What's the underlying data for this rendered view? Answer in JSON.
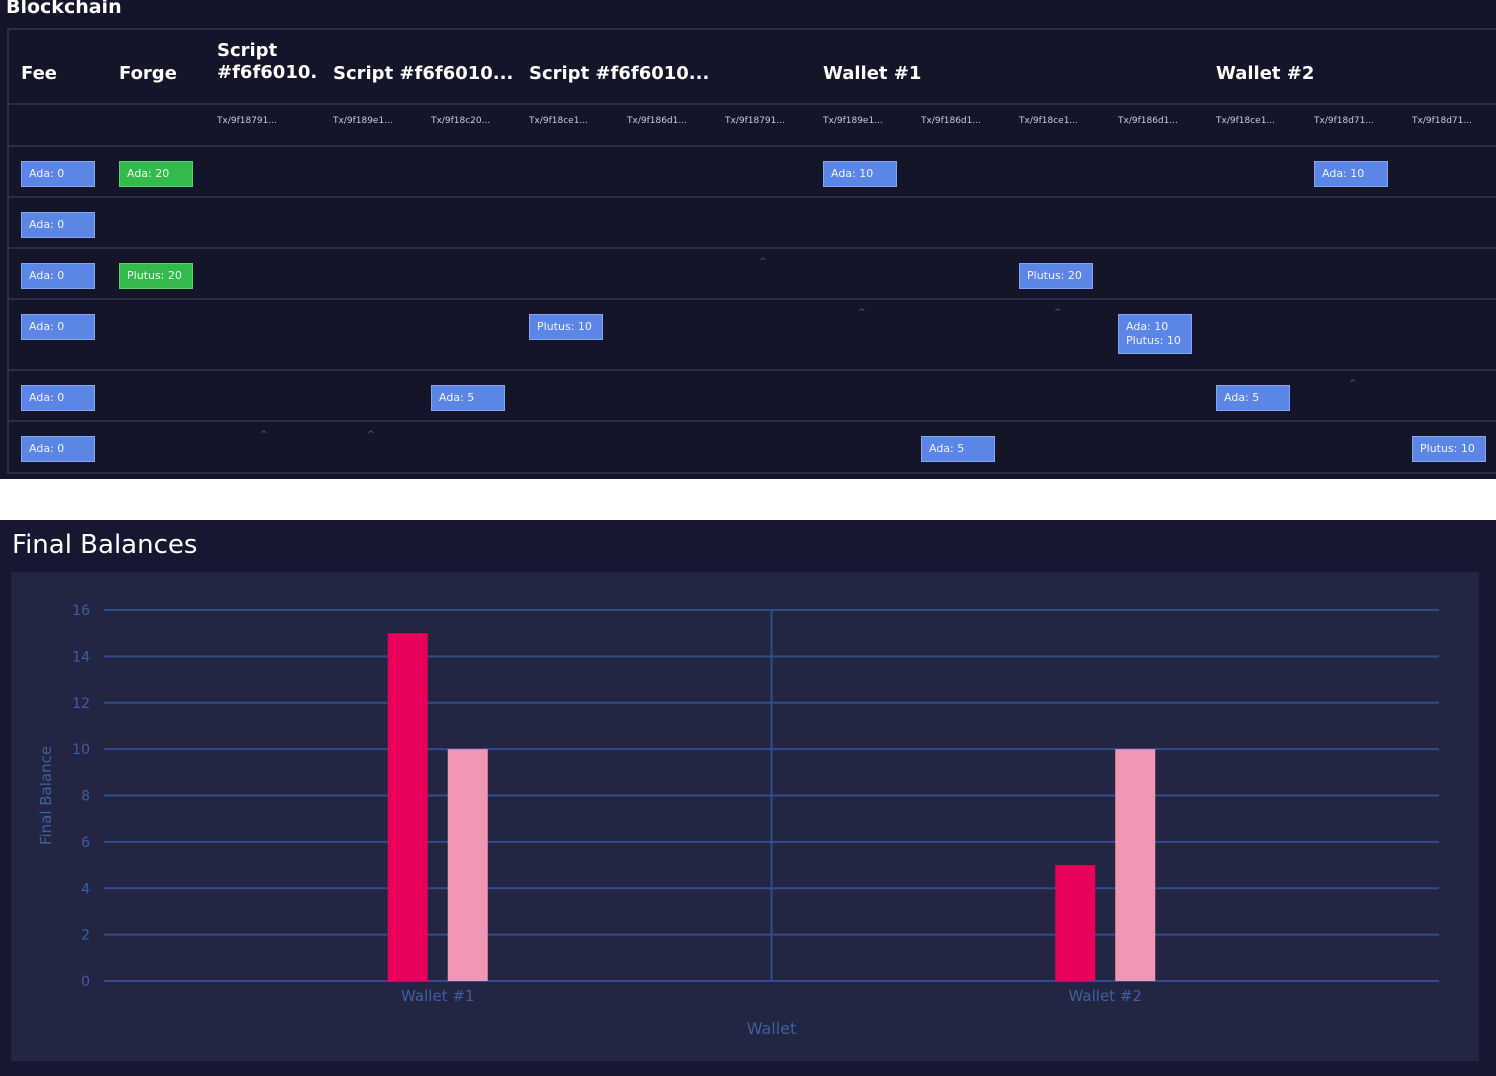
{
  "blockchain": {
    "title": "Blockchain",
    "columns": [
      {
        "label": "Fee"
      },
      {
        "label": "Forge"
      },
      {
        "label": "Script #f6f6010..."
      },
      {
        "label": "Script #f6f6010..."
      },
      {
        "label": "Script #f6f6010..."
      },
      {
        "label": "Wallet #1"
      },
      {
        "label": "Wallet #2"
      }
    ],
    "tx_labels": [
      "Tx/9f18791...",
      "Tx/9f189e1...",
      "Tx/9f18c20...",
      "Tx/9f18ce1...",
      "Tx/9f186d1...",
      "Tx/9f18791...",
      "Tx/9f189e1...",
      "Tx/9f186d1...",
      "Tx/9f18ce1...",
      "Tx/9f186d1...",
      "Tx/9f18ce1...",
      "Tx/9f18d71...",
      "Tx/9f18d71..."
    ],
    "chips": [
      {
        "lines": [
          "Ada: 0"
        ],
        "color": "#5b86e5"
      },
      {
        "lines": [
          "Ada: 20"
        ],
        "color": "#34b94f"
      },
      {
        "lines": [
          "Ada: 10"
        ],
        "color": "#5b86e5"
      },
      {
        "lines": [
          "Ada: 10"
        ],
        "color": "#5b86e5"
      },
      {
        "lines": [
          "Ada: 0"
        ],
        "color": "#5b86e5"
      },
      {
        "lines": [
          "Ada: 0"
        ],
        "color": "#5b86e5"
      },
      {
        "lines": [
          "Plutus: 20"
        ],
        "color": "#34b94f"
      },
      {
        "lines": [
          "Plutus: 20"
        ],
        "color": "#5b86e5"
      },
      {
        "lines": [
          "Ada: 0"
        ],
        "color": "#5b86e5"
      },
      {
        "lines": [
          "Plutus: 10"
        ],
        "color": "#5b86e5"
      },
      {
        "lines": [
          "Ada: 10",
          "Plutus: 10"
        ],
        "color": "#5b86e5"
      },
      {
        "lines": [
          "Ada: 0"
        ],
        "color": "#5b86e5"
      },
      {
        "lines": [
          "Ada: 5"
        ],
        "color": "#5b86e5"
      },
      {
        "lines": [
          "Ada: 5"
        ],
        "color": "#5b86e5"
      },
      {
        "lines": [
          "Ada: 0"
        ],
        "color": "#5b86e5"
      },
      {
        "lines": [
          "Ada: 5"
        ],
        "color": "#5b86e5"
      },
      {
        "lines": [
          "Plutus: 10"
        ],
        "color": "#5b86e5"
      }
    ],
    "caret_glyph": "^"
  },
  "final_balances": {
    "title": "Final Balances"
  },
  "chart_data": {
    "type": "bar",
    "title": "Final Balances",
    "xlabel": "Wallet",
    "ylabel": "Final Balance",
    "categories": [
      "Wallet #1",
      "Wallet #2"
    ],
    "series": [
      {
        "values": [
          15,
          5
        ],
        "color": "#e8005a"
      },
      {
        "values": [
          10,
          10
        ],
        "color": "#f297b3"
      }
    ],
    "ylim": [
      0,
      16
    ],
    "yticks": [
      0,
      2,
      4,
      6,
      8,
      10,
      12,
      14,
      16
    ],
    "grid": true,
    "legend": "none"
  }
}
